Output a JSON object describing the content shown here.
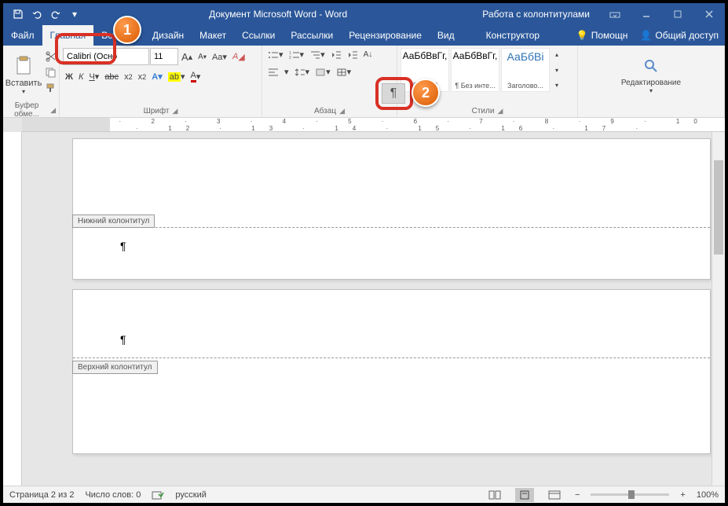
{
  "title": "Документ Microsoft Word - Word",
  "context_title": "Работа с колонтитулами",
  "tabs": {
    "file": "Файл",
    "home": "Главная",
    "insert": "Вставка",
    "design": "Дизайн",
    "layout": "Макет",
    "references": "Ссылки",
    "mailings": "Рассылки",
    "review": "Рецензирование",
    "view": "Вид",
    "designer": "Конструктор",
    "help": "Помощн",
    "share": "Общий доступ"
  },
  "ribbon": {
    "clipboard": {
      "paste": "Вставить",
      "label": "Буфер обме..."
    },
    "font": {
      "name": "Calibri (Осно",
      "size": "11",
      "label": "Шрифт"
    },
    "paragraph": {
      "label": "Абзац"
    },
    "styles": {
      "label": "Стили",
      "items": [
        {
          "preview": "АаБбВвГг,",
          "name": "бычный"
        },
        {
          "preview": "АаБбВвГг,",
          "name": "¶ Без инте..."
        },
        {
          "preview": "АаБбВі",
          "name": "Заголово..."
        }
      ]
    },
    "editing": {
      "label": "Редактирование"
    }
  },
  "doc": {
    "footer_label": "Нижний колонтитул",
    "header_label": "Верхний колонтитул",
    "pilcrow": "¶"
  },
  "status": {
    "page": "Страница 2 из 2",
    "words": "Число слов: 0",
    "lang": "русский",
    "zoom": "100%"
  },
  "callouts": {
    "one": "1",
    "two": "2"
  }
}
